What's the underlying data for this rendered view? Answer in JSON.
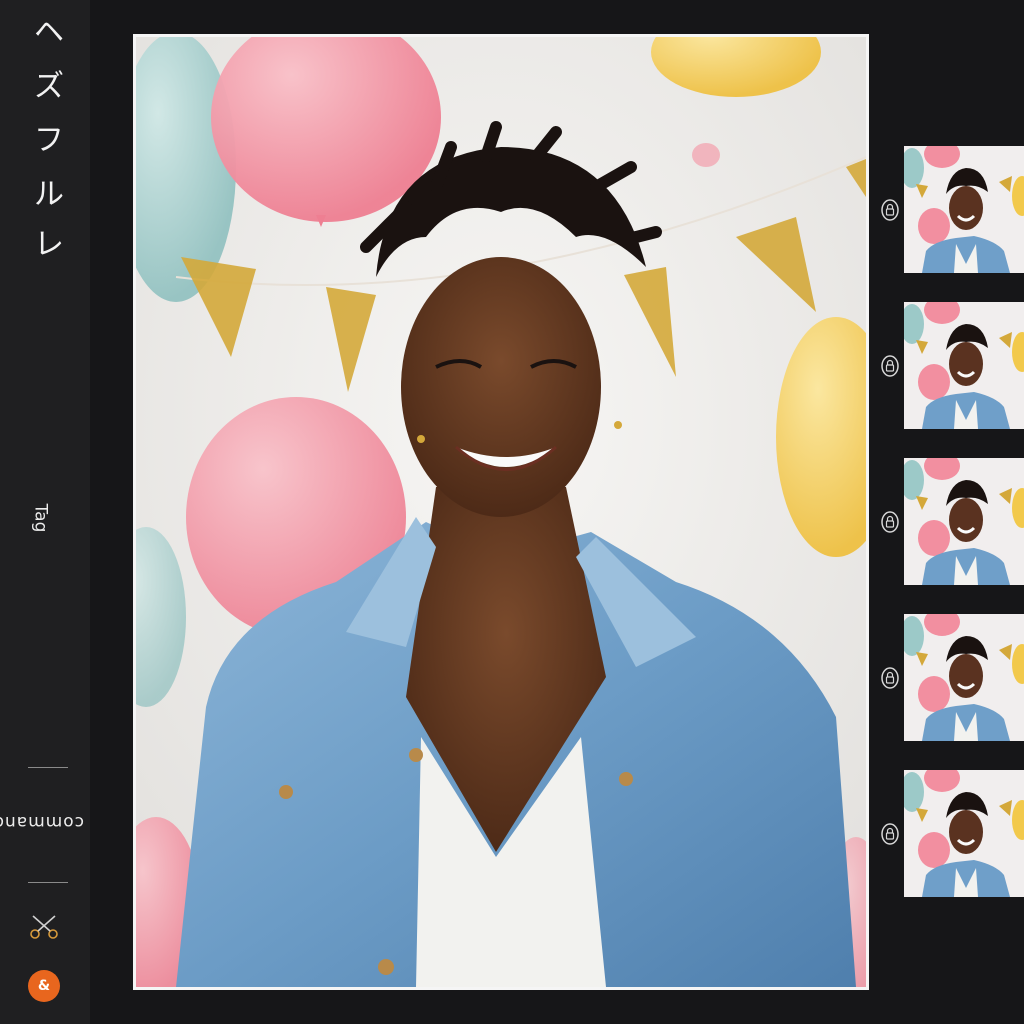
{
  "sidebar": {
    "glyphs": [
      "ヘ",
      "ズ",
      "フ",
      "ル",
      "レ"
    ],
    "tag_label": "Tag",
    "command_label": "command",
    "tool_icon": "scissors-icon",
    "status_icon": "logo-icon",
    "status_glyph": "&"
  },
  "main_photo": {
    "subject": "portrait",
    "background_color": "#ececec",
    "accent_colors": [
      "#9cc9c8",
      "#f28fa0",
      "#f2c94c",
      "#d4a83a",
      "#6f9fc9"
    ]
  },
  "filmstrip": {
    "count": 5,
    "item_icon": "lock-icon"
  },
  "colors": {
    "app_background": "#161618",
    "sidebar_background": "#1f1f21",
    "frame_border": "#f5f5f5",
    "accent_orange": "#e8661e"
  }
}
